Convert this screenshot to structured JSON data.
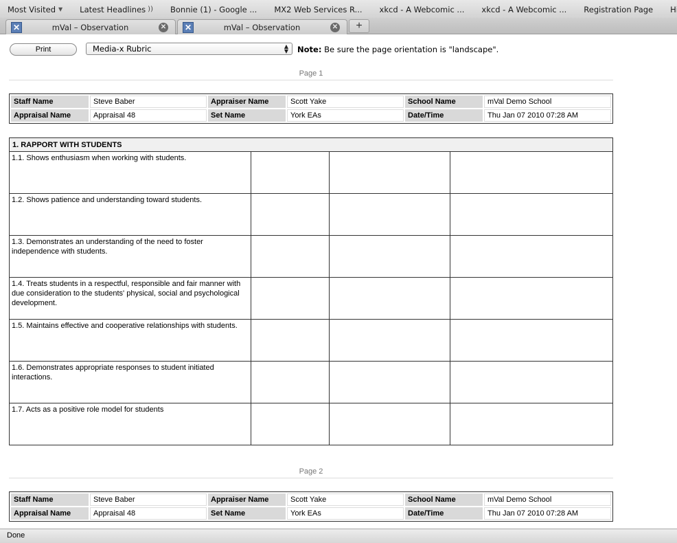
{
  "bookmarks": [
    {
      "label": "Most Visited",
      "has_arrow": true
    },
    {
      "label": "Latest Headlines",
      "has_rss": true
    },
    {
      "label": "Bonnie (1) - Google ..."
    },
    {
      "label": "MX2 Web Services R..."
    },
    {
      "label": "xkcd - A Webcomic ..."
    },
    {
      "label": "xkcd - A Webcomic ..."
    },
    {
      "label": "Registration Page"
    },
    {
      "label": "Highrise Le"
    }
  ],
  "tabs": [
    {
      "title": "mVal – Observation"
    },
    {
      "title": "mVal – Observation"
    }
  ],
  "new_tab_label": "+",
  "toolbar": {
    "print_label": "Print",
    "rubric_select": "Media-x Rubric",
    "note_label": "Note:",
    "note_text": "Be sure the page orientation is \"landscape\"."
  },
  "pages": [
    {
      "label": "Page 1",
      "info": {
        "staff_name_label": "Staff Name",
        "staff_name": "Steve Baber",
        "appraiser_name_label": "Appraiser Name",
        "appraiser_name": "Scott Yake",
        "school_name_label": "School Name",
        "school_name": "mVal Demo School",
        "appraisal_name_label": "Appraisal Name",
        "appraisal_name": "Appraisal 48",
        "set_name_label": "Set Name",
        "set_name": "York EAs",
        "datetime_label": "Date/Time",
        "datetime": "Thu Jan 07 2010 07:28 AM"
      }
    },
    {
      "label": "Page 2",
      "info": {
        "staff_name_label": "Staff Name",
        "staff_name": "Steve Baber",
        "appraiser_name_label": "Appraiser Name",
        "appraiser_name": "Scott Yake",
        "school_name_label": "School Name",
        "school_name": "mVal Demo School",
        "appraisal_name_label": "Appraisal Name",
        "appraisal_name": "Appraisal 48",
        "set_name_label": "Set Name",
        "set_name": "York EAs",
        "datetime_label": "Date/Time",
        "datetime": "Thu Jan 07 2010 07:28 AM"
      }
    }
  ],
  "rubric": {
    "section_title": "1. RAPPORT WITH STUDENTS",
    "items": [
      "1.1. Shows enthusiasm when working with students.",
      "1.2. Shows patience and understanding toward students.",
      "1.3. Demonstrates an understanding of the need to foster independence with students.",
      "1.4. Treats students in a respectful, responsible and fair manner with due consideration to the students' physical, social and psychological development.",
      "1.5. Maintains effective and cooperative relationships with students.",
      "1.6. Demonstrates appropriate responses to student initiated interactions.",
      "1.7. Acts as a positive role model for students"
    ]
  },
  "status_text": "Done"
}
